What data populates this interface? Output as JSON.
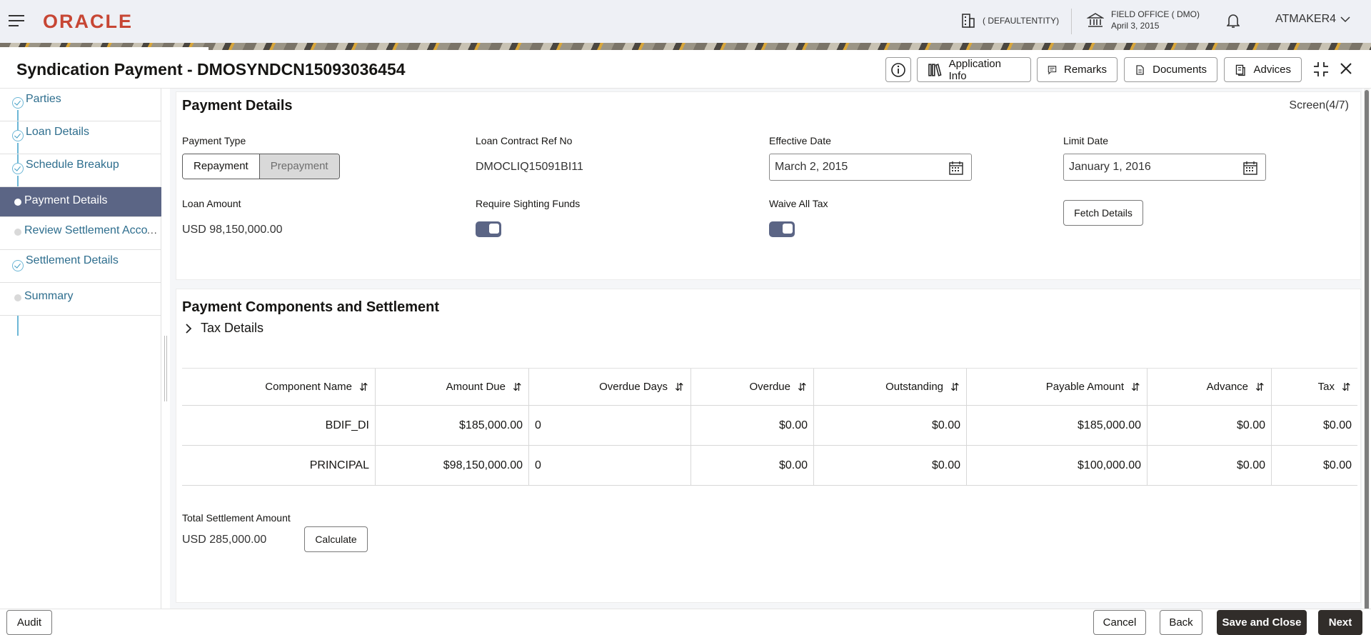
{
  "header": {
    "logo_text": "ORACLE",
    "entity": "( DEFAULTENTITY)",
    "office_name": "FIELD OFFICE ( DMO)",
    "office_date": "April 3, 2015",
    "user": "ATMAKER4"
  },
  "titlebar": {
    "title": "Syndication Payment - DMOSYNDCN15093036454",
    "application_info": "Application Info",
    "remarks": "Remarks",
    "documents": "Documents",
    "advices": "Advices"
  },
  "nav": {
    "items": [
      {
        "label": "Parties",
        "state": "done"
      },
      {
        "label": "Loan Details",
        "state": "done"
      },
      {
        "label": "Schedule Breakup",
        "state": "done"
      },
      {
        "label": "Payment Details",
        "state": "active"
      },
      {
        "label": "Review Settlement Acco",
        "state": "pending"
      },
      {
        "label": "Settlement Details",
        "state": "done"
      },
      {
        "label": "Summary",
        "state": "pending"
      }
    ],
    "more": "..."
  },
  "payment_details": {
    "section_title": "Payment Details",
    "screen": "Screen(4/7)",
    "payment_type_label": "Payment Type",
    "payment_type_options": [
      "Repayment",
      "Prepayment"
    ],
    "payment_type_selected": "Repayment",
    "loan_contract_label": "Loan Contract Ref No",
    "loan_contract_value": "DMOCLIQ15091BI11",
    "effective_date_label": "Effective Date",
    "effective_date_value": "March 2, 2015",
    "limit_date_label": "Limit Date",
    "limit_date_value": "January 1, 2016",
    "loan_amount_label": "Loan Amount",
    "loan_amount_value": "USD 98,150,000.00",
    "sighting_funds_label": "Require Sighting Funds",
    "sighting_funds_on": true,
    "waive_tax_label": "Waive All Tax",
    "waive_tax_on": true,
    "fetch_button": "Fetch Details"
  },
  "components": {
    "section_title": "Payment Components and Settlement",
    "tax_details": "Tax Details",
    "columns": [
      "Component Name",
      "Amount Due",
      "Overdue Days",
      "Overdue",
      "Outstanding",
      "Payable Amount",
      "Advance",
      "Tax"
    ],
    "rows": [
      [
        "BDIF_DI",
        "$185,000.00",
        "0",
        "$0.00",
        "$0.00",
        "$185,000.00",
        "$0.00",
        "$0.00"
      ],
      [
        "PRINCIPAL",
        "$98,150,000.00",
        "0",
        "$0.00",
        "$0.00",
        "$100,000.00",
        "$0.00",
        "$0.00"
      ]
    ],
    "total_label": "Total Settlement Amount",
    "total_value": "USD 285,000.00",
    "calculate_button": "Calculate"
  },
  "footer": {
    "audit": "Audit",
    "cancel": "Cancel",
    "back": "Back",
    "save_close": "Save and Close",
    "next": "Next"
  },
  "colors": {
    "brand": "#c74634",
    "nav_active": "#5b6585",
    "link": "#2e6e8e",
    "primary_button": "#312d2a"
  }
}
